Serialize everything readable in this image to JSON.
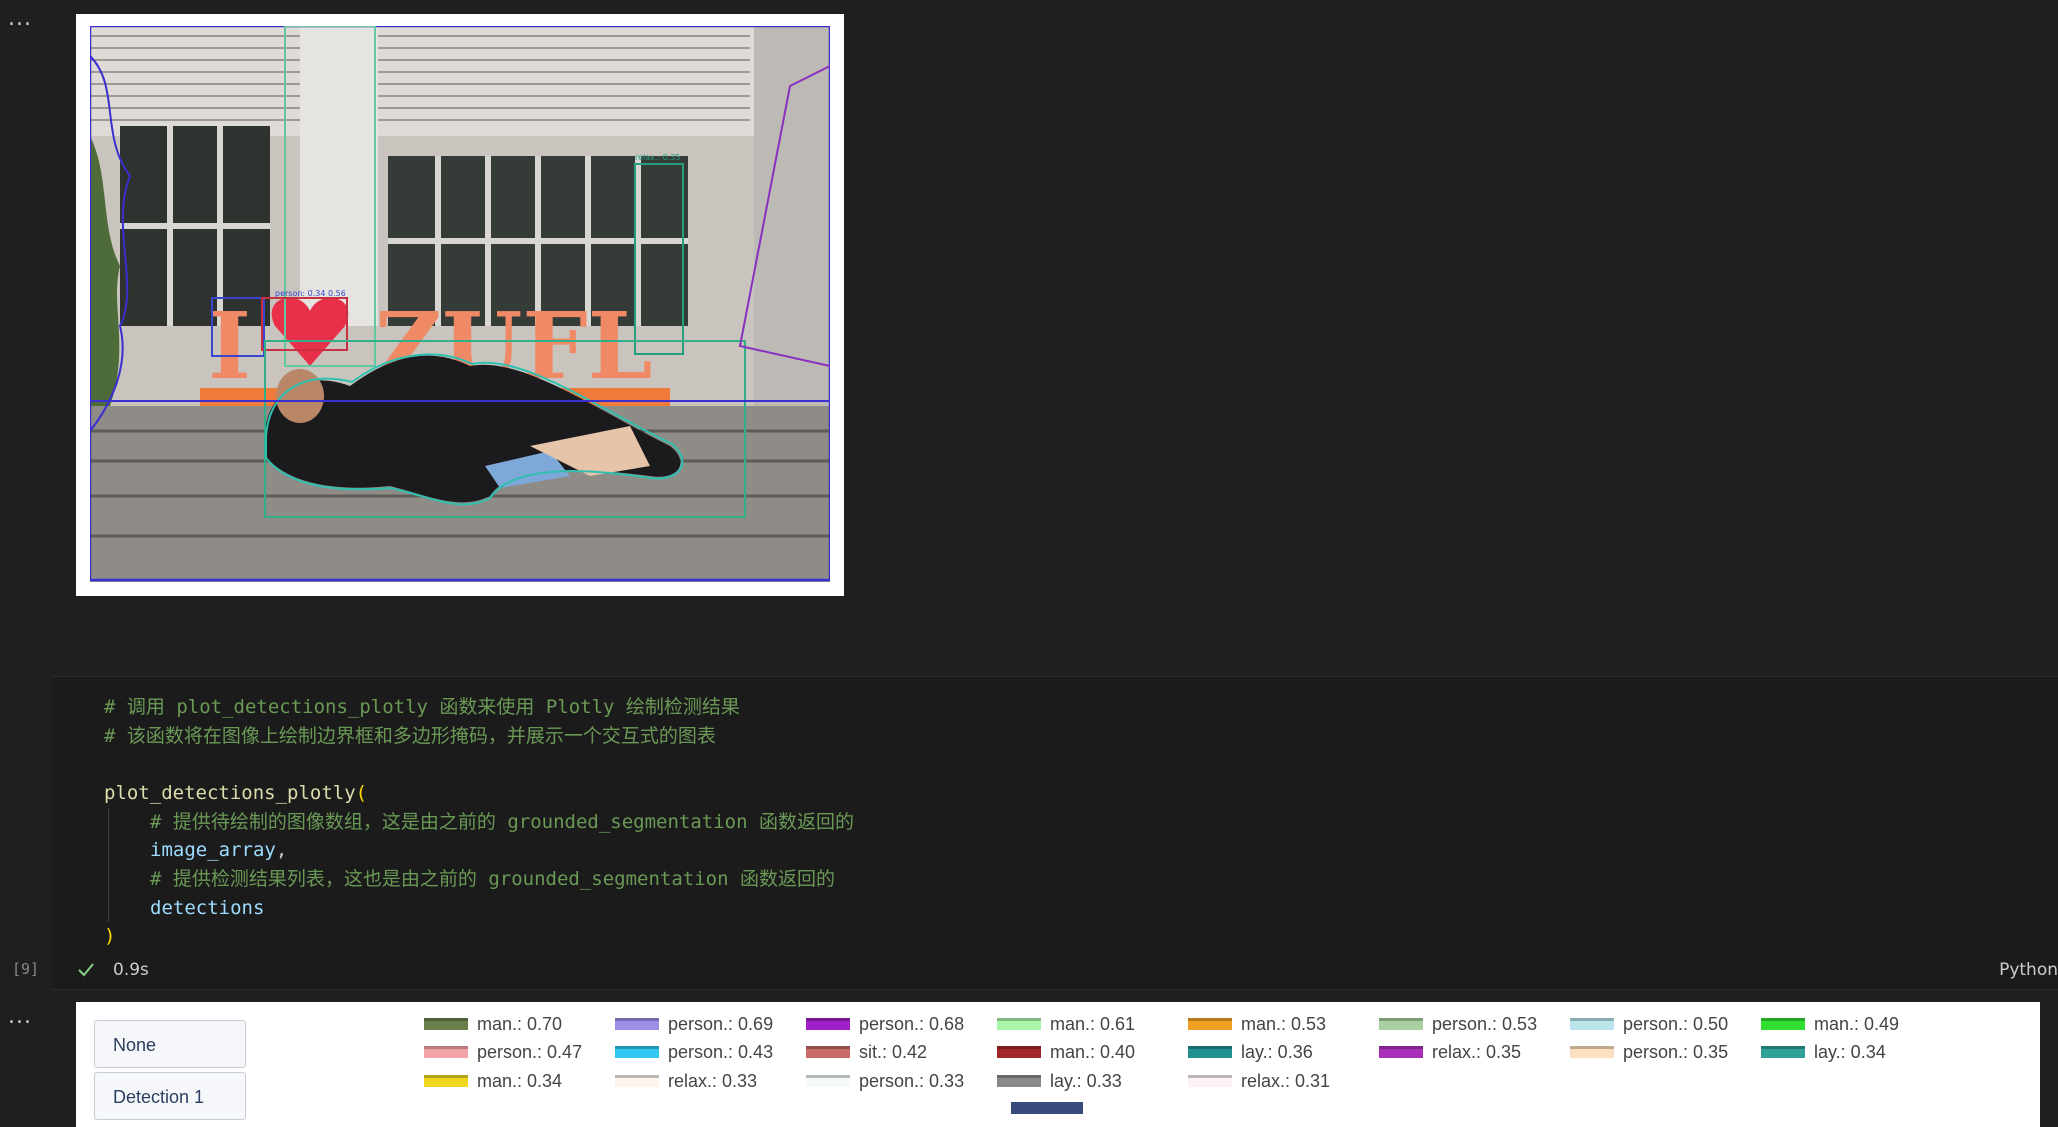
{
  "more_label": "...",
  "code": {
    "comment1": "# 调用 plot_detections_plotly 函数来使用 Plotly 绘制检测结果",
    "comment2": "# 该函数将在图像上绘制边界框和多边形掩码，并展示一个交互式的图表",
    "func_name": "plot_detections_plotly",
    "open_paren": "(",
    "comment3": "# 提供待绘制的图像数组，这是由之前的 grounded_segmentation 函数返回的",
    "arg1": "image_array",
    "comma": ",",
    "comment4": "# 提供检测结果列表，这也是由之前的 grounded_segmentation 函数返回的",
    "arg2": "detections",
    "close_paren": ")"
  },
  "status": {
    "exec_count": "[9]",
    "exec_time": "0.9s",
    "language": "Python"
  },
  "image_labels": {
    "box_label_a": "relax.: 0.35",
    "box_label_b": "person: 0.34 0.56"
  },
  "plot": {
    "buttons": [
      "None",
      "Detection 1"
    ],
    "legend": [
      {
        "label": "man.: 0.70",
        "color": "#6b7f4a"
      },
      {
        "label": "person.: 0.69",
        "color": "#9b8fe8"
      },
      {
        "label": "person.: 0.68",
        "color": "#a020c8"
      },
      {
        "label": "man.: 0.61",
        "color": "#a8f5a8"
      },
      {
        "label": "man.: 0.53",
        "color": "#f0a020"
      },
      {
        "label": "person.: 0.53",
        "color": "#a8d0a0"
      },
      {
        "label": "person.: 0.50",
        "color": "#b8e4ec"
      },
      {
        "label": "man.: 0.49",
        "color": "#30e030"
      },
      {
        "label": "person.: 0.47",
        "color": "#f4a4a8"
      },
      {
        "label": "person.: 0.43",
        "color": "#30c8f0"
      },
      {
        "label": "sit.: 0.42",
        "color": "#c86a6a"
      },
      {
        "label": "man.: 0.40",
        "color": "#a02828"
      },
      {
        "label": "lay.: 0.36",
        "color": "#209090"
      },
      {
        "label": "relax.: 0.35",
        "color": "#a830b8"
      },
      {
        "label": "person.: 0.35",
        "color": "#fce0c0"
      },
      {
        "label": "lay.: 0.34",
        "color": "#30a098"
      },
      {
        "label": "man.: 0.34",
        "color": "#f0d820"
      },
      {
        "label": "relax.: 0.33",
        "color": "#fdf4ec"
      },
      {
        "label": "person.: 0.33",
        "color": "#f4faf6"
      },
      {
        "label": "lay.: 0.33",
        "color": "#8a8a8a"
      },
      {
        "label": "relax.: 0.31",
        "color": "#fcf2f4"
      }
    ]
  }
}
